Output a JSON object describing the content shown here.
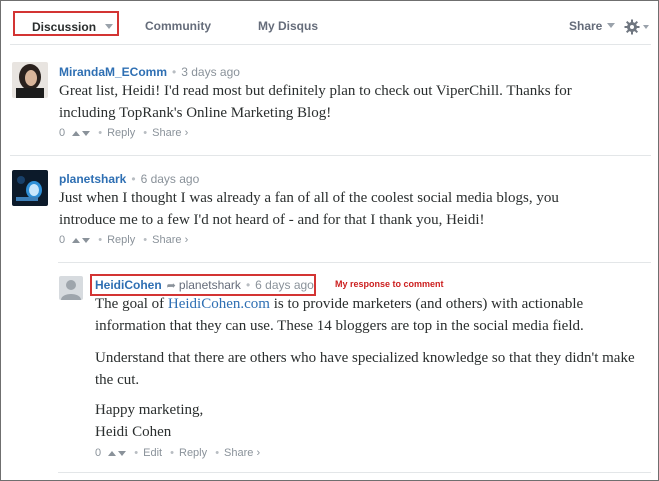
{
  "nav": {
    "tabs": [
      {
        "label": "Discussion"
      },
      {
        "label": "Community"
      },
      {
        "label": "My Disqus"
      }
    ],
    "share_label": "Share"
  },
  "comments": [
    {
      "author": "MirandaM_EComm",
      "time": "3 days ago",
      "text": "Great list, Heidi! I'd read most but definitely plan to check out ViperChill. Thanks for including TopRank's Online Marketing Blog!",
      "votes": "0",
      "reply": "Reply",
      "share": "Share ›"
    },
    {
      "author": "planetshark",
      "time": "6 days ago",
      "text": "Just when I thought I was already a fan of all of the coolest social media blogs, you introduce me to a few I'd not heard of - and for that I thank you, Heidi!",
      "votes": "0",
      "reply": "Reply",
      "share": "Share ›"
    }
  ],
  "reply": {
    "author": "HeidiCohen",
    "reply_to": "planetshark",
    "time": "6 days ago",
    "annotation": "My response to comment",
    "para1_before": "The goal of ",
    "para1_link": "HeidiCohen.com",
    "para1_after": " is to provide marketers (and others) with actionable information that they can use. These 14 bloggers are top in the social media field.",
    "para2": "Understand that there are others who have specialized knowledge so that they didn't make the cut.",
    "para3_line1": "Happy marketing,",
    "para3_line2": "Heidi Cohen",
    "votes": "0",
    "edit": "Edit",
    "reply": "Reply",
    "share": "Share ›"
  },
  "icons": {
    "gear": "gear-icon",
    "caret": "chevron-down-icon",
    "reply_arrow": "reply-arrow-icon",
    "vote_up": "upvote-icon",
    "vote_down": "downvote-icon"
  },
  "colors": {
    "link": "#2e6fb3",
    "highlight": "#d33433",
    "muted": "#8a929a"
  }
}
